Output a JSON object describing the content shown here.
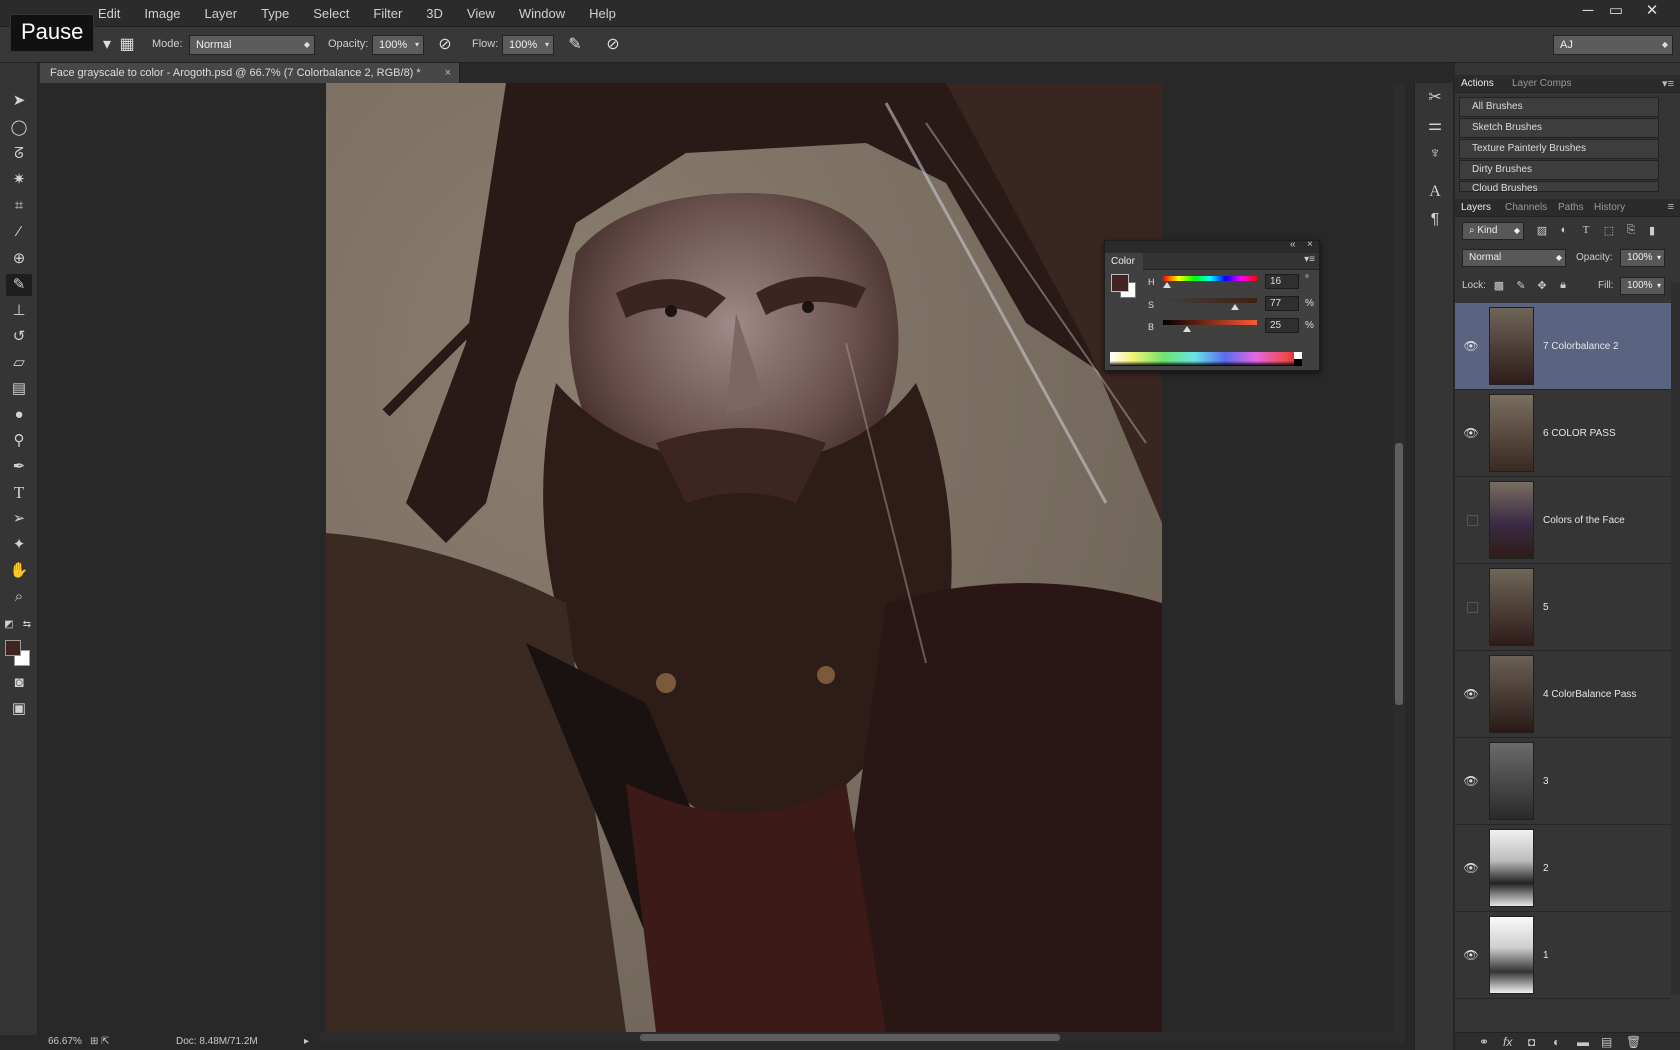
{
  "overlay": {
    "pause_label": "Pause"
  },
  "menubar": {
    "items": [
      "Edit",
      "Image",
      "Layer",
      "Type",
      "Select",
      "Filter",
      "3D",
      "View",
      "Window",
      "Help"
    ],
    "win_controls": [
      "─",
      "▭",
      "✕"
    ]
  },
  "options": {
    "mode_label": "Mode:",
    "mode_value": "Normal",
    "opacity_label": "Opacity:",
    "opacity_value": "100%",
    "flow_label": "Flow:",
    "flow_value": "100%",
    "workspace_value": "AJ"
  },
  "document": {
    "tab_title": "Face grayscale to color - Arogoth.psd @ 66.7% (7 Colorbalance 2, RGB/8) *",
    "zoom": "66.67%",
    "doc_size": "Doc: 8.48M/71.2M"
  },
  "colors": {
    "foreground": "#40241f",
    "background": "#ffffff",
    "selection": "#5a6380"
  },
  "brush_panel": {
    "tabs": [
      "Actions",
      "Layer Comps"
    ],
    "items": [
      "All Brushes",
      "Sketch Brushes",
      "Texture Painterly Brushes",
      "Dirty Brushes",
      "Cloud Brushes"
    ]
  },
  "layers_panel": {
    "tabs": [
      "Layers",
      "Channels",
      "Paths",
      "History"
    ],
    "kind_label": "Kind",
    "blend_mode": "Normal",
    "opacity_label": "Opacity:",
    "opacity_value": "100%",
    "lock_label": "Lock:",
    "fill_label": "Fill:",
    "fill_value": "100%",
    "layers": [
      {
        "name": "7 Colorbalance 2",
        "visible": true,
        "selected": true
      },
      {
        "name": "6 COLOR PASS",
        "visible": true,
        "selected": false
      },
      {
        "name": "Colors of the Face",
        "visible": false,
        "selected": false
      },
      {
        "name": "5",
        "visible": false,
        "selected": false
      },
      {
        "name": "4 ColorBalance Pass",
        "visible": true,
        "selected": false
      },
      {
        "name": "3",
        "visible": true,
        "selected": false
      },
      {
        "name": "2",
        "visible": true,
        "selected": false
      },
      {
        "name": "1",
        "visible": true,
        "selected": false
      }
    ]
  },
  "color_panel": {
    "title": "Color",
    "h_label": "H",
    "s_label": "S",
    "b_label": "B",
    "h_value": "16",
    "s_value": "77",
    "b_value": "25",
    "h_unit": "°",
    "s_unit": "%",
    "b_unit": "%",
    "h_max": 360,
    "s_max": 100,
    "b_max": 100
  }
}
